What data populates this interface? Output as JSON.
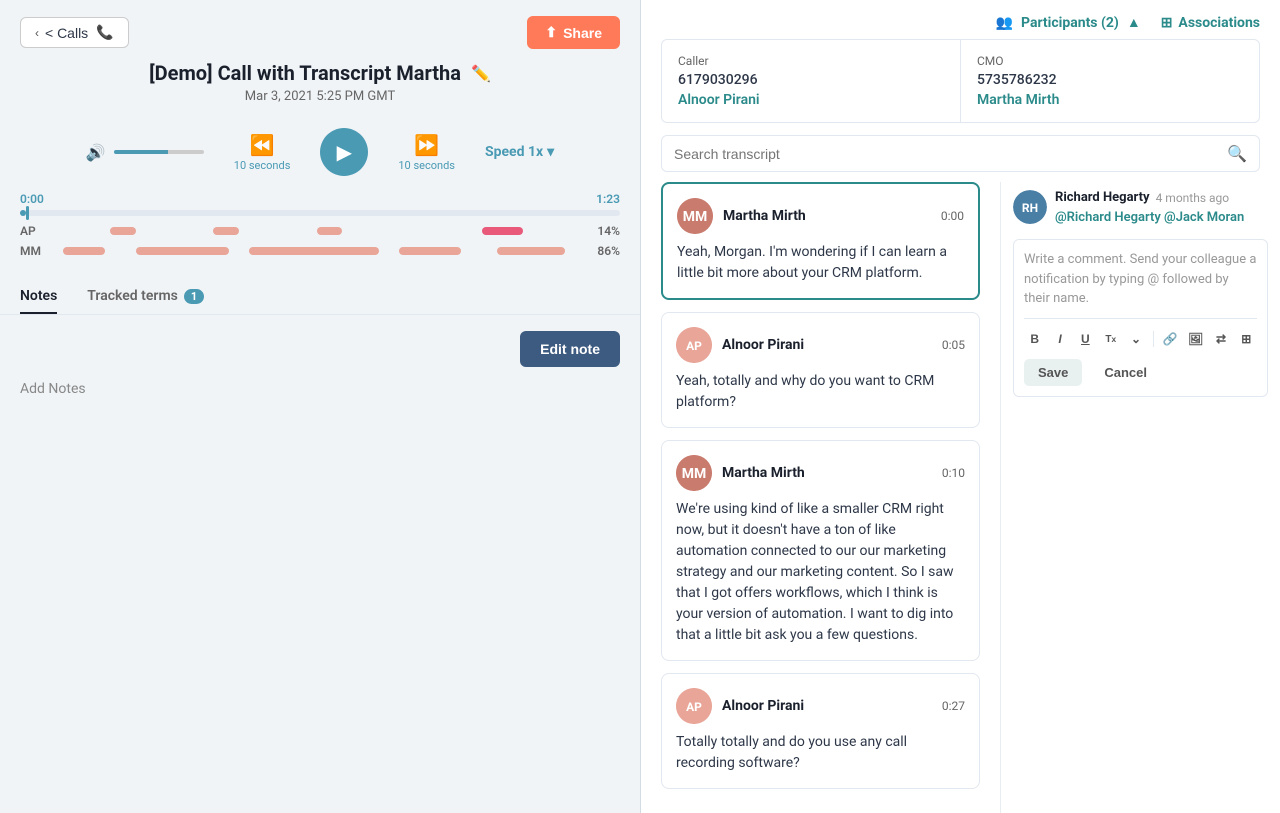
{
  "left": {
    "back_button": "< Calls",
    "share_button": "Share",
    "call_title": "[Demo] Call with Transcript Martha",
    "call_date": "Mar 3, 2021 5:25 PM GMT",
    "audio": {
      "skip_back_label": "10 seconds",
      "skip_forward_label": "10 seconds",
      "speed_label": "Speed 1x",
      "time_start": "0:00",
      "time_end": "1:23"
    },
    "speakers": [
      {
        "label": "AP",
        "pct_label": "14%",
        "pct": 14,
        "color": "#e8a598"
      },
      {
        "label": "MM",
        "pct_label": "86%",
        "pct": 86,
        "color": "#e8a598"
      }
    ],
    "tabs": [
      {
        "label": "Notes",
        "active": true,
        "badge": null
      },
      {
        "label": "Tracked terms",
        "active": false,
        "badge": "1"
      }
    ],
    "edit_note_label": "Edit note",
    "add_notes_label": "Add Notes"
  },
  "right": {
    "participants_label": "Participants (2)",
    "associations_label": "Associations",
    "caller_label": "Caller",
    "cmo_label": "CMO",
    "caller_phone": "6179030296",
    "cmo_phone": "5735786232",
    "caller_name": "Alnoor Pirani",
    "cmo_name": "Martha Mirth",
    "search_placeholder": "Search transcript",
    "transcript": [
      {
        "speaker": "Martha Mirth",
        "time": "0:00",
        "text": "Yeah, Morgan. I'm wondering if I can learn a little bit more about your CRM platform.",
        "avatar_type": "mm",
        "active": true
      },
      {
        "speaker": "Alnoor Pirani",
        "time": "0:05",
        "text": "Yeah, totally and why do you want to CRM platform?",
        "avatar_type": "ap",
        "active": false
      },
      {
        "speaker": "Martha Mirth",
        "time": "0:10",
        "text": "We're using kind of like a smaller CRM right now, but it doesn't have a ton of like automation connected to our our marketing strategy and our marketing content. So I saw that I got offers workflows, which I think is your version of automation. I want to dig into that a little bit ask you a few questions.",
        "avatar_type": "mm",
        "active": false
      },
      {
        "speaker": "Alnoor Pirani",
        "time": "0:27",
        "text": "Totally totally and do you use any call recording software?",
        "avatar_type": "ap",
        "active": false
      }
    ],
    "comment": {
      "author": "Richard Hegarty",
      "time": "4 months ago",
      "text": "@Richard Hegarty @Jack Moran",
      "mentions": [
        "@Richard Hegarty",
        "@Jack Moran"
      ]
    },
    "editor": {
      "placeholder": "Write a comment. Send your colleague a notification by typing @ followed by their name.",
      "save_label": "Save",
      "cancel_label": "Cancel"
    },
    "toolbar_items": [
      "B",
      "I",
      "U",
      "Tx",
      "⌄",
      "🔗",
      "🖼",
      "⇄",
      "⊞"
    ]
  }
}
